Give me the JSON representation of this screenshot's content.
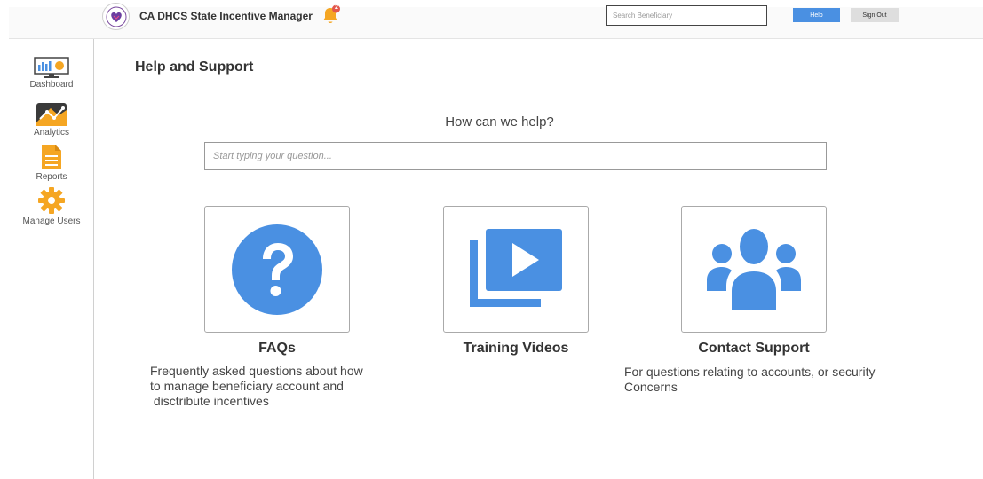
{
  "header": {
    "app_title": "CA DHCS State Incentive Manager",
    "search_placeholder": "Search Beneficiary",
    "help_label": "Help",
    "signout_label": "Sign Out",
    "notification_badge": "2"
  },
  "sidebar": {
    "items": [
      {
        "label": "Dashboard",
        "icon": "dashboard-monitor-icon"
      },
      {
        "label": "Analytics",
        "icon": "analytics-chart-icon"
      },
      {
        "label": "Reports",
        "icon": "reports-document-icon"
      },
      {
        "label": "Manage Users",
        "icon": "gear-icon"
      }
    ]
  },
  "main": {
    "page_title": "Help and Support",
    "help_heading": "How can we help?",
    "question_placeholder": "Start typing your question...",
    "cards": [
      {
        "title": "FAQs",
        "description_lines": [
          "Frequently asked questions about how",
          "to manage beneficiary account and",
          " disctribute incentives"
        ],
        "icon": "question-circle-icon"
      },
      {
        "title": "Training Videos",
        "description_lines": [],
        "icon": "video-library-icon"
      },
      {
        "title": "Contact Support",
        "description_lines": [
          "For questions relating to accounts, or security",
          "Concerns"
        ],
        "icon": "users-group-icon"
      }
    ]
  },
  "colors": {
    "accent": "#4a90e2",
    "icon_blue": "#4a90e2",
    "orange": "#f5a623"
  }
}
